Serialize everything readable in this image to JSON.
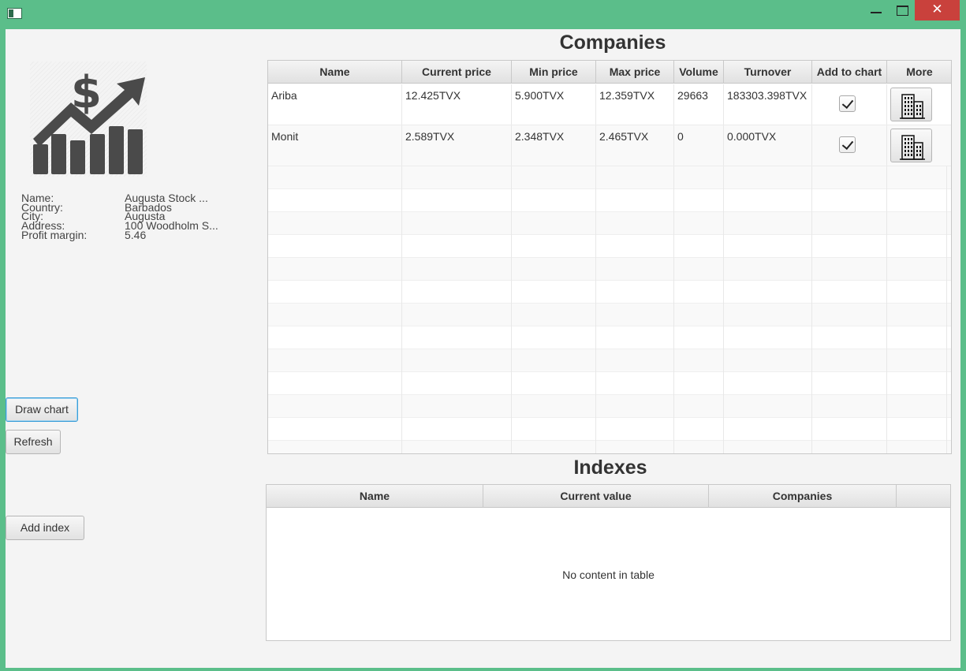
{
  "window": {
    "close_glyph": "✕"
  },
  "exchange": {
    "fields": [
      {
        "label": "Name:",
        "value": "Augusta Stock ..."
      },
      {
        "label": "Country:",
        "value": "Barbados"
      },
      {
        "label": "City:",
        "value": "Augusta"
      },
      {
        "label": "Address:",
        "value": "100 Woodholm S..."
      },
      {
        "label": "Profit margin:",
        "value": "5.46"
      }
    ]
  },
  "buttons": {
    "draw_chart": "Draw chart",
    "refresh": "Refresh",
    "add_index": "Add index"
  },
  "companies": {
    "title": "Companies",
    "columns": [
      "Name",
      "Current price",
      "Min price",
      "Max price",
      "Volume",
      "Turnover",
      "Add to chart",
      "More"
    ],
    "rows": [
      {
        "name": "Ariba",
        "current_price": "12.425TVX",
        "min_price": "5.900TVX",
        "max_price": "12.359TVX",
        "volume": "29663",
        "turnover": "183303.398TVX",
        "add_to_chart": true
      },
      {
        "name": "Monit",
        "current_price": "2.589TVX",
        "min_price": "2.348TVX",
        "max_price": "2.465TVX",
        "volume": "0",
        "turnover": "0.000TVX",
        "add_to_chart": true
      }
    ]
  },
  "indexes": {
    "title": "Indexes",
    "columns": [
      "Name",
      "Current value",
      "Companies"
    ],
    "empty_message": "No content in table"
  },
  "colors": {
    "window_frame": "#5bbe8a",
    "close_button": "#c9413c",
    "focus_ring": "#3a9ed8",
    "logo": "#4a4a4a"
  },
  "icons": [
    "app-icon",
    "minimize-icon",
    "maximize-icon",
    "close-icon",
    "stock-chart-logo",
    "building-icon",
    "checkmark-icon"
  ]
}
